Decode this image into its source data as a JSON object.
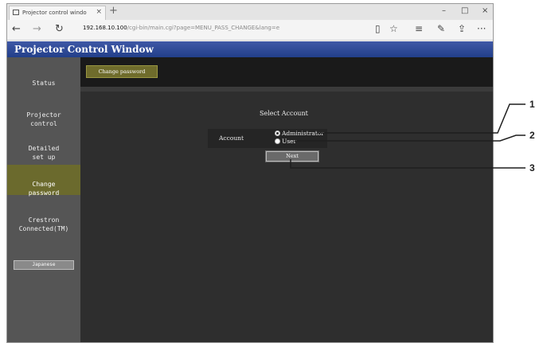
{
  "browser": {
    "tab_title": "Projector control windo",
    "tab_close": "×",
    "new_tab": "+",
    "window_controls": {
      "minimize": "–",
      "maximize": "□",
      "close": "×"
    },
    "nav": {
      "back": "←",
      "forward": "→",
      "refresh": "↻"
    },
    "url_host": "192.168.10.100",
    "url_path": "/cgi-bin/main.cgi?page=MENU_PASS_CHANGE&lang=e",
    "toolbar_icons": {
      "reading_view": "▯",
      "favorite": "☆",
      "hub": "≡",
      "notes": "✎",
      "share": "⇪",
      "more": "···"
    }
  },
  "app": {
    "title": "Projector Control Window",
    "header_color": "#2a4590"
  },
  "sidebar": {
    "items": [
      {
        "label": "Status",
        "active": false
      },
      {
        "label": "Projector\ncontrol",
        "active": false
      },
      {
        "label": "Detailed\nset up",
        "active": false
      },
      {
        "label": "Change\npassword",
        "active": true
      },
      {
        "label": "Crestron\nConnected(TM)",
        "active": false
      }
    ],
    "language_button": "Japanese",
    "active_color": "#6b6a2d"
  },
  "content": {
    "subtab": "Change password",
    "select_title": "Select Account",
    "account_label": "Account",
    "options": [
      {
        "label": "Administrator",
        "checked": true
      },
      {
        "label": "User",
        "checked": false
      }
    ],
    "next_button": "Next"
  },
  "callouts": [
    "1",
    "2",
    "3"
  ]
}
